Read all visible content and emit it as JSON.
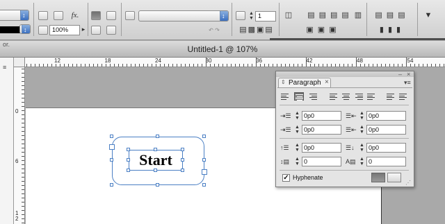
{
  "control_bar": {
    "zoom_value": "100%",
    "columns_value": "1",
    "fx_label": "fx.",
    "ruler_mark": "or."
  },
  "document": {
    "title": "Untitled-1 @ 107%"
  },
  "ruler": {
    "h_labels": [
      "12",
      "18",
      "24",
      "30",
      "36",
      "42",
      "48",
      "54"
    ],
    "v_labels": [
      "0",
      "6",
      "1\n2"
    ]
  },
  "text_frame": {
    "text": "Start"
  },
  "paragraph_panel": {
    "tab_label": "Paragraph",
    "left_indent": "0p0",
    "right_indent": "0p0",
    "first_line_indent": "0p0",
    "last_line_indent": "0p0",
    "space_before": "0p0",
    "space_after": "0p0",
    "drop_cap_lines": "0",
    "drop_cap_chars": "0",
    "hyphenate_label": "Hyphenate",
    "hyphenate_checked": true
  },
  "colors": {
    "selection": "#4a7fc4",
    "page": "#ffffff",
    "pasteboard": "#a9a9a9"
  }
}
